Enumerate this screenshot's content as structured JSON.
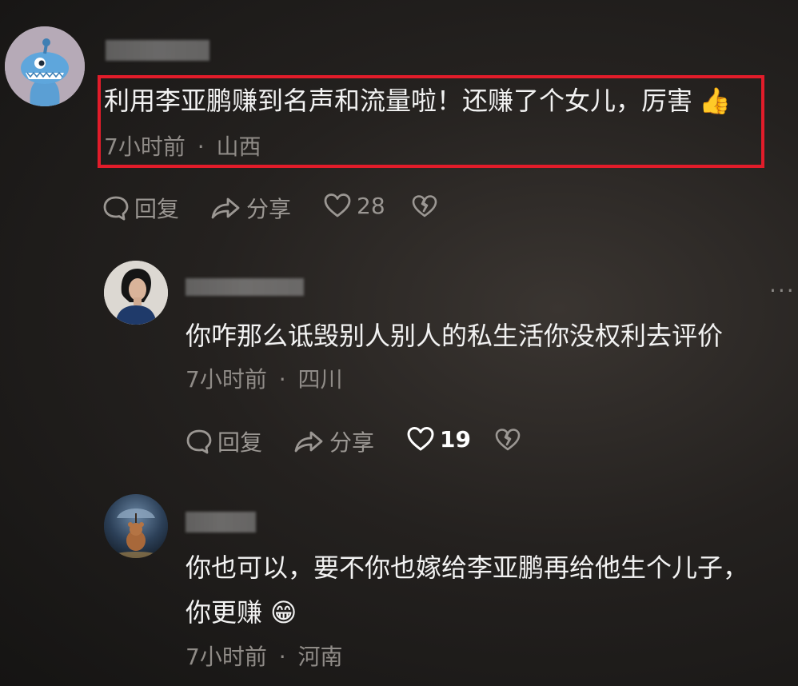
{
  "comments": [
    {
      "text": "利用李亚鹏赚到名声和流量啦！还赚了个女儿，厉害",
      "emoji": "👍",
      "time": "7小时前",
      "separator": "·",
      "location": "山西",
      "reply_label": "回复",
      "share_label": "分享",
      "likes": "28"
    },
    {
      "text": "你咋那么诋毁别人别人的私生活你没权利去评价",
      "time": "7小时前",
      "separator": "·",
      "location": "四川",
      "reply_label": "回复",
      "share_label": "分享",
      "likes": "19"
    },
    {
      "text_line1": "你也可以，要不你也嫁给李亚鹏再给他生个儿子，",
      "text_line2": "你更赚",
      "emoji": "😁",
      "time": "7小时前",
      "separator": "·",
      "location": "河南"
    }
  ],
  "colors": {
    "highlight_border": "#e21c2a",
    "meta_text": "#8f8b87",
    "action_text": "#9b9793"
  },
  "icons": {
    "reply": "speech-bubble-icon",
    "share": "share-arrow-icon",
    "like": "heart-icon",
    "dislike": "broken-heart-icon",
    "more": "more-dots-icon"
  }
}
